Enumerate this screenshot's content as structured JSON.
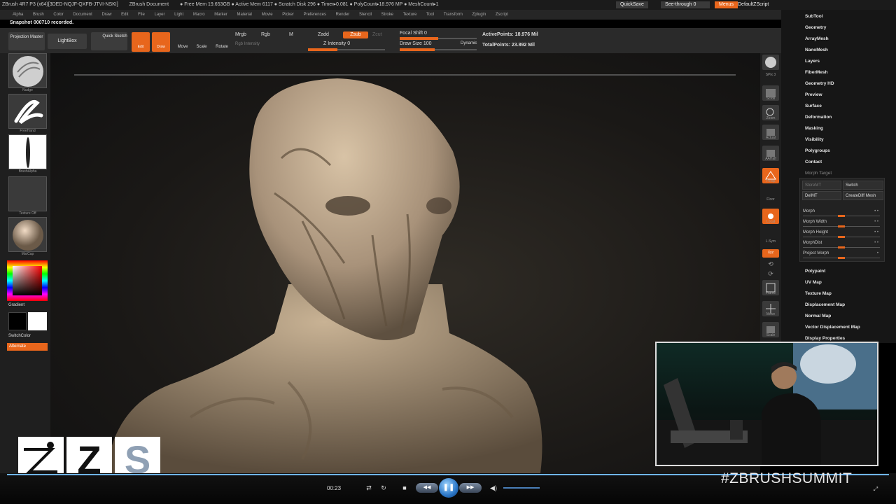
{
  "titlebar": {
    "app": "ZBrush 4R7 P3 (x64)[3DED-NQJF-QXFB-JTVI-NSKI]",
    "document": "ZBrush Document",
    "stats": "● Free Mem 19.653GB ● Active Mem 6117 ● Scratch Disk 296 ● Timer▸0.081 ● PolyCount▸18.976 MP ● MeshCount▸1",
    "quicksave": "QuickSave",
    "seethrough": "See-through 0",
    "menus": "Menus",
    "script": "DefaultZScript"
  },
  "menubar": [
    "Alpha",
    "Brush",
    "Color",
    "Document",
    "Draw",
    "Edit",
    "File",
    "Layer",
    "Light",
    "Macro",
    "Marker",
    "Material",
    "Movie",
    "Picker",
    "Preferences",
    "Render",
    "Stencil",
    "Stroke",
    "Texture",
    "Tool",
    "Transform",
    "Zplugin",
    "Zscript"
  ],
  "status": "Snapshot 000710 recorded.",
  "toolbar": {
    "projection_master": "Projection Master",
    "lightbox": "LightBox",
    "quick_sketch": "Quick Sketch",
    "edit": "Edit",
    "draw": "Draw",
    "move": "Move",
    "scale": "Scale",
    "rotate": "Rotate",
    "mrgb": "Mrgb",
    "rgb": "Rgb",
    "m": "M",
    "rgb_intensity": "Rgb Intensity",
    "zadd": "Zadd",
    "zsub": "Zsub",
    "zcut": "Zcut",
    "z_intensity": "Z Intensity 0",
    "focal_shift": "Focal Shift 0",
    "draw_size": "Draw Size 100",
    "dynamic": "Dynamic",
    "active_points": "ActivePoints: 18.976 Mil",
    "total_points": "TotalPoints: 23.892 Mil"
  },
  "left": {
    "brush": "Nudge",
    "stroke": "FreeHand",
    "alpha": "BrushAlpha",
    "texture": "Texture Off",
    "material": "MatCap",
    "gradient": "Gradient",
    "switch": "SwitchColor",
    "alternate": "Alternate",
    "colors": {
      "main": "#000000",
      "secondary": "#ffffff"
    }
  },
  "right": [
    "SPix 3",
    "Scroll",
    "Zoom",
    "Actual",
    "AAHalf",
    "Persp",
    "Floor",
    "Local",
    "L.Sym",
    "Xyz",
    "",
    "",
    "Frame",
    "Move",
    "Scale"
  ],
  "subtool": {
    "items": [
      "SubTool",
      "Geometry",
      "ArrayMesh",
      "NanoMesh",
      "Layers",
      "FiberMesh",
      "Geometry HD",
      "Preview",
      "Surface",
      "Deformation",
      "Masking",
      "Visibility",
      "Polygroups",
      "Contact"
    ],
    "morph_target": "Morph Target",
    "buttons": [
      "StoreMT",
      "Switch",
      "DelMT",
      "CreateDiff Mesh"
    ],
    "sliders": [
      "Morph",
      "Morph Width",
      "Morph Height",
      "MorphDist",
      "Project Morph"
    ],
    "items2": [
      "Polypaint",
      "UV Map",
      "Texture Map",
      "Displacement Map",
      "Normal Map",
      "Vector Displacement Map",
      "Display Properties"
    ]
  },
  "player": {
    "time": "00:23",
    "hashtag": "#ZBRUSHSUMMIT",
    "logo_letters": [
      "Z",
      "S"
    ],
    "accent": "#e8661c",
    "progress_color": "#6fb5ff"
  }
}
